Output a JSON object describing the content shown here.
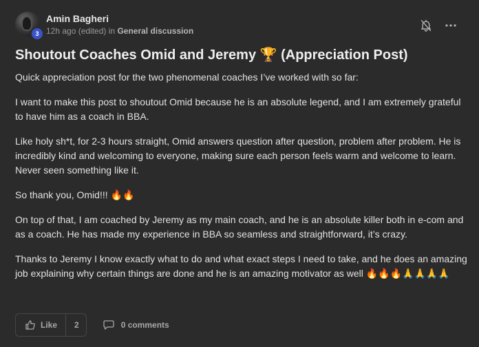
{
  "author": {
    "name": "Amin Bagheri",
    "level": "3",
    "time": "12h ago (edited)",
    "in_label": "in",
    "category": "General discussion"
  },
  "post": {
    "title": "Shoutout Coaches Omid and Jeremy 🏆 (Appreciation Post)",
    "paragraphs": [
      "Quick appreciation post for the two phenomenal coaches I’ve worked with so far:",
      "I want to make this post to shoutout Omid because he is an absolute legend, and I am extremely grateful to have him as a coach in BBA.",
      "Like holy sh*t, for 2-3 hours straight, Omid answers question after question, problem after problem. He is incredibly kind and welcoming to everyone, making sure each person feels warm and welcome to learn. Never seen something like it.",
      "So thank you, Omid!!! 🔥🔥",
      "On top of that, I am coached by Jeremy as my main coach, and he is an absolute killer both in e-com and as a coach. He has made my experience in BBA so seamless and straightforward, it’s crazy.",
      "Thanks to Jeremy I know exactly what to do and what exact steps I need to take, and he does an amazing job explaining why certain things are done and he is an amazing motivator as well 🔥🔥🔥🙏🙏🙏🙏"
    ]
  },
  "actions": {
    "like_label": "Like",
    "like_count": "2",
    "comments_label": "0 comments"
  },
  "icons": {
    "bell": "bell-icon",
    "more": "more-icon",
    "like": "thumbs-up-icon",
    "comment": "comment-icon"
  },
  "colors": {
    "background": "#2b2b2b",
    "level_badge": "#3b53c9",
    "muted_text": "#9a9a9a"
  }
}
